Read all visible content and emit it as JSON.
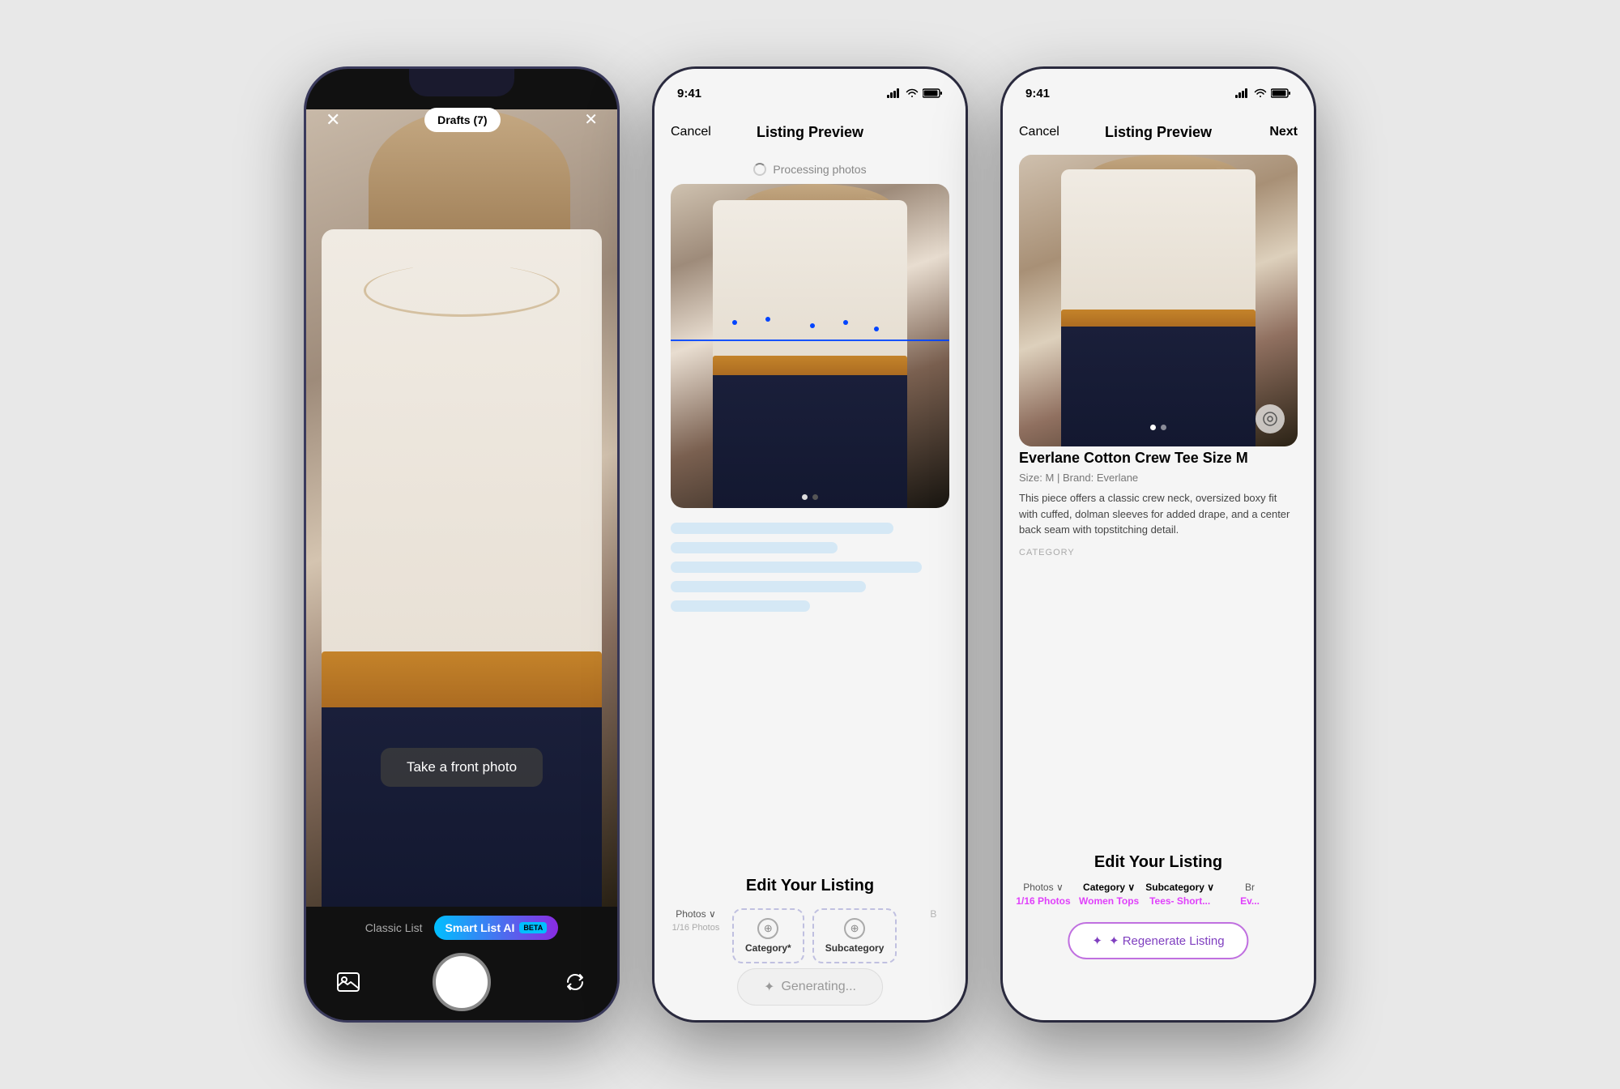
{
  "phone1": {
    "topbar": {
      "close_label": "✕",
      "drafts_label": "Drafts (7)",
      "flash_label": "✕"
    },
    "viewfinder": {
      "overlay_text": "Take a front photo"
    },
    "bottom": {
      "mode_classic": "Classic List",
      "mode_smart": "Smart List AI",
      "beta_label": "BETA",
      "shutter_label": ""
    }
  },
  "phone2": {
    "status": {
      "time": "9:41"
    },
    "header": {
      "cancel_label": "Cancel",
      "title": "Listing Preview"
    },
    "processing": {
      "text": "Processing photos"
    },
    "edit_section": {
      "title": "Edit Your Listing",
      "tabs": [
        {
          "label": "Photos ∨",
          "sub": "1/16 Photos"
        },
        {
          "label": "Category*",
          "sub": "",
          "selected": true
        },
        {
          "label": "Subcategory",
          "sub": "",
          "selected": true
        },
        {
          "label": "B",
          "sub": ""
        }
      ]
    },
    "generating": {
      "label": "Generating..."
    }
  },
  "phone3": {
    "status": {
      "time": "9:41"
    },
    "header": {
      "cancel_label": "Cancel",
      "title": "Listing Preview",
      "next_label": "Next"
    },
    "listing": {
      "title": "Everlane Cotton Crew Tee Size M",
      "meta": "Size: M  |  Brand: Everlane",
      "description": "This piece offers a classic crew neck, oversized boxy fit with cuffed, dolman sleeves for added drape, and a center back seam with topstitching detail.",
      "category_label": "CATEGORY"
    },
    "edit_section": {
      "title": "Edit Your Listing",
      "tabs": [
        {
          "label": "Photos ∨",
          "sub": "1/16 Photos"
        },
        {
          "label": "Category ∨",
          "sub": "Women Tops",
          "active": true
        },
        {
          "label": "Subcategory ∨",
          "sub": "Tees- Short...",
          "active": true
        },
        {
          "label": "Br",
          "sub": "Ev..."
        }
      ]
    },
    "regen": {
      "label": "✦ Regenerate Listing"
    }
  }
}
